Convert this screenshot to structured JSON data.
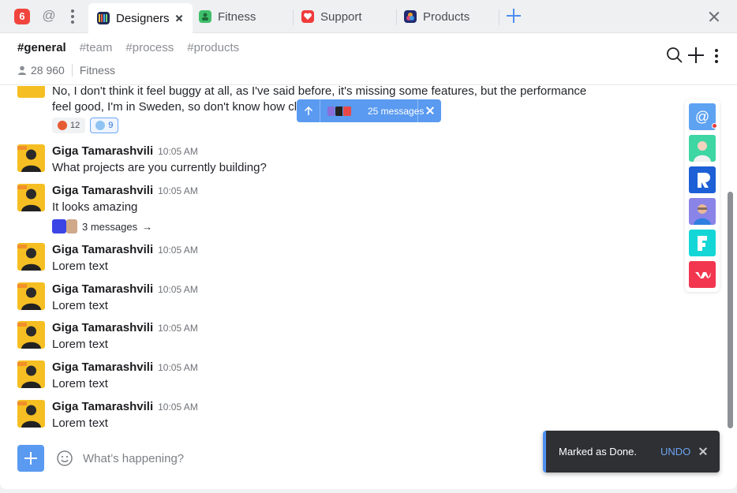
{
  "tabs_bar": {
    "app_badge": "6",
    "tabs": [
      {
        "label": "Designers",
        "icon": "designers-icon",
        "active": true
      },
      {
        "label": "Fitness",
        "icon": "fitness-icon",
        "active": false
      },
      {
        "label": "Support",
        "icon": "support-icon",
        "active": false
      },
      {
        "label": "Products",
        "icon": "products-icon",
        "active": false
      }
    ]
  },
  "header": {
    "channels": [
      "#general",
      "#team",
      "#process",
      "#products"
    ],
    "member_count": "28 960",
    "workspace": "Fitness"
  },
  "first_message": {
    "text": "No, I don't think it feel buggy at all, as I've said before, it's missing some features, but the performance feel good, I'm in Sweden, so don't know how cl",
    "reactions": [
      {
        "emoji": "angry-face",
        "count": "12",
        "mine": false
      },
      {
        "emoji": "fearful-face",
        "count": "9",
        "mine": true
      }
    ]
  },
  "jump_pill": {
    "label": "25 messages"
  },
  "messages": [
    {
      "author": "Giga Tamarashvili",
      "time": "10:05 AM",
      "text": "What projects are you currently building?"
    },
    {
      "author": "Giga Tamarashvili",
      "time": "10:05 AM",
      "text": "It looks amazing",
      "thread": {
        "label": "3 messages",
        "arrow": "→"
      }
    },
    {
      "author": "Giga Tamarashvili",
      "time": "10:05 AM",
      "text": "Lorem text"
    },
    {
      "author": "Giga Tamarashvili",
      "time": "10:05 AM",
      "text": "Lorem text"
    },
    {
      "author": "Giga Tamarashvili",
      "time": "10:05 AM",
      "text": "Lorem text"
    },
    {
      "author": "Giga Tamarashvili",
      "time": "10:05 AM",
      "text": "Lorem text"
    },
    {
      "author": "Giga Tamarashvili",
      "time": "10:05 AM",
      "text": "Lorem text"
    }
  ],
  "app_rail": [
    "mentions-app",
    "person-app",
    "r-app",
    "person-app-2",
    "f-app",
    "red-app"
  ],
  "composer": {
    "placeholder": "What’s happening?"
  },
  "toast": {
    "message": "Marked as Done.",
    "action": "UNDO"
  },
  "colors": {
    "accent": "#5a9af0",
    "badge": "#f0453d",
    "toast_bg": "#2e3033",
    "avatar_bg": "#f5bf23"
  }
}
